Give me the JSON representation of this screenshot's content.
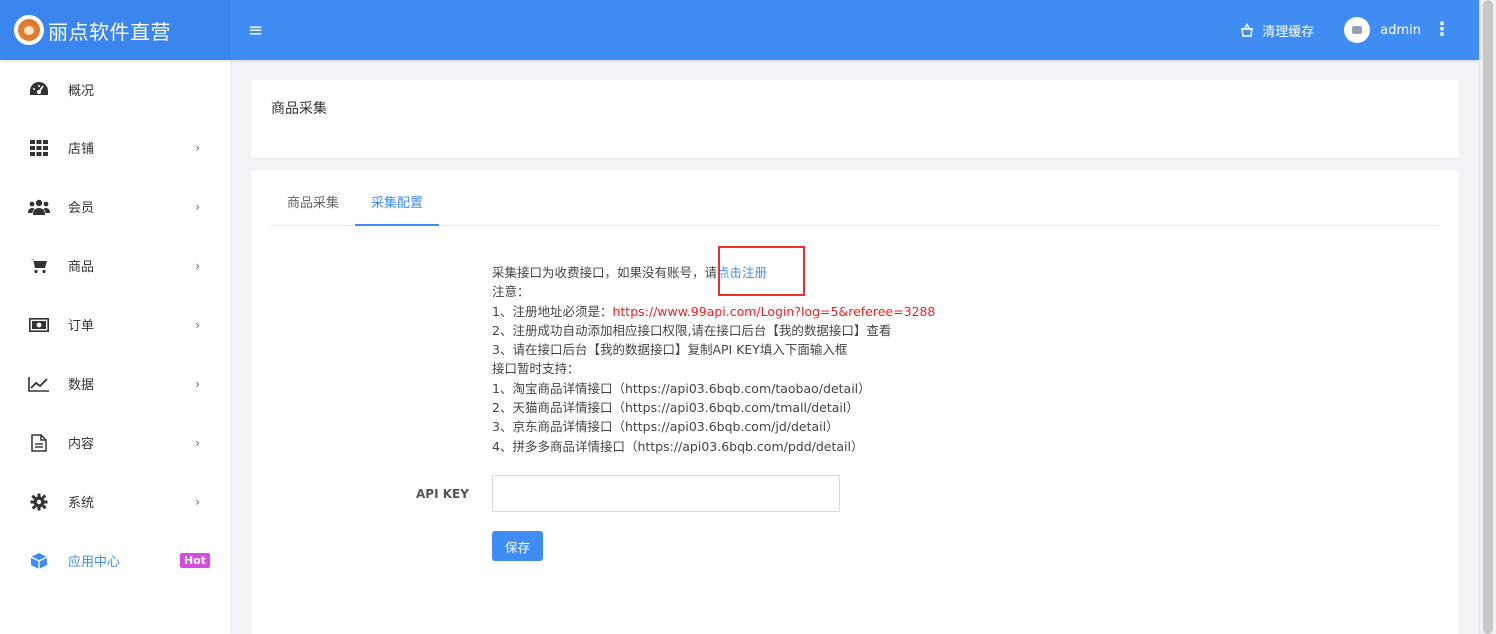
{
  "header": {
    "brand": "丽点软件直营",
    "clear_cache": "清理缓存",
    "username": "admin"
  },
  "sidebar": {
    "items": [
      {
        "label": "概况",
        "icon": "dashboard-icon"
      },
      {
        "label": "店铺",
        "icon": "grid-icon"
      },
      {
        "label": "会员",
        "icon": "users-icon"
      },
      {
        "label": "商品",
        "icon": "cart-icon"
      },
      {
        "label": "订单",
        "icon": "money-icon"
      },
      {
        "label": "数据",
        "icon": "chart-icon"
      },
      {
        "label": "内容",
        "icon": "document-icon"
      },
      {
        "label": "系统",
        "icon": "gear-icon"
      },
      {
        "label": "应用中心",
        "icon": "cube-icon",
        "badge": "Hot"
      }
    ],
    "arrow": "›"
  },
  "page": {
    "title": "商品采集"
  },
  "tabs": [
    {
      "label": "商品采集"
    },
    {
      "label": "采集配置"
    }
  ],
  "notice": {
    "line1_prefix": "采集接口为收费接口，如果没有账号，请",
    "register_link": "点击注册",
    "line2": "注意：",
    "line3_prefix": "1、注册地址必须是：",
    "register_url": "https://www.99api.com/Login?log=5&referee=3288",
    "line4": "2、注册成功自动添加相应接口权限,请在接口后台【我的数据接口】查看",
    "line5": "3、请在接口后台【我的数据接口】复制API KEY填入下面输入框",
    "line6": "接口暂时支持：",
    "line7": "1、淘宝商品详情接口（https://api03.6bqb.com/taobao/detail）",
    "line8": "2、天猫商品详情接口（https://api03.6bqb.com/tmall/detail）",
    "line9": "3、京东商品详情接口（https://api03.6bqb.com/jd/detail）",
    "line10": "4、拼多多商品详情接口（https://api03.6bqb.com/pdd/detail）"
  },
  "form": {
    "api_key_label": "API KEY",
    "api_key_value": "",
    "save_label": "保存"
  },
  "colors": {
    "primary": "#3f8cf2",
    "danger": "#f01f1f",
    "badge": "#d94be0"
  }
}
